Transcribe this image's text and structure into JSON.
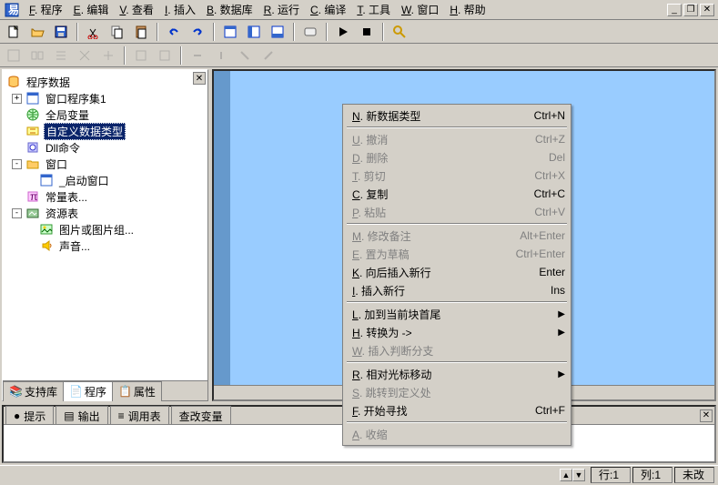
{
  "menubar": {
    "items": [
      {
        "u": "F",
        "label": ". 程序"
      },
      {
        "u": "E",
        "label": ". 编辑"
      },
      {
        "u": "V",
        "label": ". 查看"
      },
      {
        "u": "I",
        "label": ". 插入"
      },
      {
        "u": "B",
        "label": ". 数据库"
      },
      {
        "u": "R",
        "label": ". 运行"
      },
      {
        "u": "C",
        "label": ". 编译"
      },
      {
        "u": "T",
        "label": ". 工具"
      },
      {
        "u": "W",
        "label": ". 窗口"
      },
      {
        "u": "H",
        "label": ". 帮助"
      }
    ]
  },
  "tree": {
    "root": "程序数据",
    "l1": [
      {
        "icon": "window",
        "label": "窗口程序集1",
        "exp": "+"
      },
      {
        "icon": "globe",
        "label": "全局变量"
      },
      {
        "icon": "dtype",
        "label": "自定义数据类型",
        "selected": true
      },
      {
        "icon": "dll",
        "label": "Dll命令"
      }
    ],
    "win": {
      "label": "窗口",
      "exp": "-",
      "child": "_启动窗口"
    },
    "const": {
      "label": "常量表..."
    },
    "res": {
      "label": "资源表",
      "exp": "-",
      "pic": "图片或图片组...",
      "snd": "声音..."
    }
  },
  "sidebar_tabs": [
    "支持库",
    "程序",
    "属性"
  ],
  "context_menu": [
    {
      "type": "item",
      "u": "N",
      "label": ". 新数据类型",
      "shortcut": "Ctrl+N",
      "enabled": true
    },
    {
      "type": "sep"
    },
    {
      "type": "item",
      "u": "U",
      "label": ". 撤消",
      "shortcut": "Ctrl+Z",
      "enabled": false
    },
    {
      "type": "item",
      "u": "D",
      "label": ". 删除",
      "shortcut": "Del",
      "enabled": false
    },
    {
      "type": "item",
      "u": "T",
      "label": ". 剪切",
      "shortcut": "Ctrl+X",
      "enabled": false
    },
    {
      "type": "item",
      "u": "C",
      "label": ". 复制",
      "shortcut": "Ctrl+C",
      "enabled": true
    },
    {
      "type": "item",
      "u": "P",
      "label": ". 粘贴",
      "shortcut": "Ctrl+V",
      "enabled": false
    },
    {
      "type": "sep"
    },
    {
      "type": "item",
      "u": "M",
      "label": ". 修改备注",
      "shortcut": "Alt+Enter",
      "enabled": false
    },
    {
      "type": "item",
      "u": "E",
      "label": ". 置为草稿",
      "shortcut": "Ctrl+Enter",
      "enabled": false
    },
    {
      "type": "item",
      "u": "K",
      "label": ". 向后插入新行",
      "shortcut": "Enter",
      "enabled": true
    },
    {
      "type": "item",
      "u": "I",
      "label": ". 插入新行",
      "shortcut": "Ins",
      "enabled": true
    },
    {
      "type": "sep"
    },
    {
      "type": "item",
      "u": "L",
      "label": ". 加到当前块首尾",
      "submenu": true,
      "enabled": true
    },
    {
      "type": "item",
      "u": "H",
      "label": ". 转换为 ->",
      "submenu": true,
      "enabled": true
    },
    {
      "type": "item",
      "u": "W",
      "label": ". 插入判断分支",
      "enabled": false
    },
    {
      "type": "sep"
    },
    {
      "type": "item",
      "u": "R",
      "label": ". 相对光标移动",
      "submenu": true,
      "enabled": true
    },
    {
      "type": "item",
      "u": "S",
      "label": ". 跳转到定义处",
      "enabled": false
    },
    {
      "type": "item",
      "u": "F",
      "label": ". 开始寻找",
      "shortcut": "Ctrl+F",
      "enabled": true
    },
    {
      "type": "sep"
    },
    {
      "type": "item",
      "u": "A",
      "label": ". 收缩",
      "enabled": false
    }
  ],
  "bottom_tabs": [
    "提示",
    "输出",
    "调用表",
    "查改变量"
  ],
  "status": {
    "row": "行:1",
    "col": "列:1",
    "mod": "未改"
  }
}
